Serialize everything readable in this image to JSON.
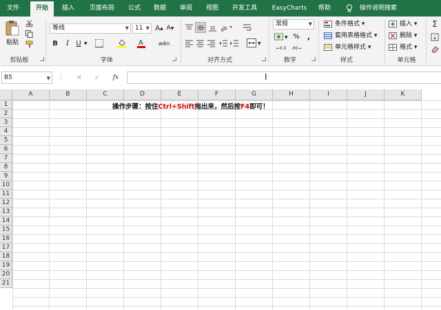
{
  "tabs": [
    "文件",
    "开始",
    "插入",
    "页面布局",
    "公式",
    "数据",
    "审阅",
    "视图",
    "开发工具",
    "EasyCharts",
    "帮助",
    "操作说明搜索"
  ],
  "active_tab": "开始",
  "clipboard": {
    "paste_label": "粘贴",
    "group_label": "剪贴板"
  },
  "font": {
    "name": "等线",
    "size": "11",
    "grow": "A",
    "shrink": "A",
    "bold": "B",
    "italic": "I",
    "underline": "U",
    "phonetic": "wén",
    "group_label": "字体"
  },
  "alignment": {
    "group_label": "对齐方式"
  },
  "number": {
    "format": "常规",
    "group_label": "数字"
  },
  "styles": {
    "conditional": "条件格式",
    "table": "套用表格格式",
    "cell": "单元格样式",
    "group_label": "样式"
  },
  "cells_group": {
    "insert": "插入",
    "delete": "删除",
    "format": "格式",
    "group_label": "单元格"
  },
  "formula_bar": {
    "name_box": "B5",
    "fx": "fx",
    "value": ""
  },
  "columns": [
    "A",
    "B",
    "C",
    "D",
    "E",
    "F",
    "G",
    "H",
    "I",
    "J",
    "K"
  ],
  "rows": [
    "1",
    "2",
    "3",
    "4",
    "5",
    "6",
    "7",
    "8",
    "9",
    "10",
    "11",
    "12",
    "13",
    "14",
    "15",
    "16",
    "17",
    "18",
    "19",
    "20",
    "21"
  ],
  "instruction": {
    "prefix": "操作步骤：按住",
    "keys1": "Ctrl+Shift",
    "middle": "拖出来，然后按",
    "keys2": "F4",
    "suffix": "即可！"
  },
  "colors": {
    "brand": "#217346",
    "highlight": "#e00000"
  }
}
